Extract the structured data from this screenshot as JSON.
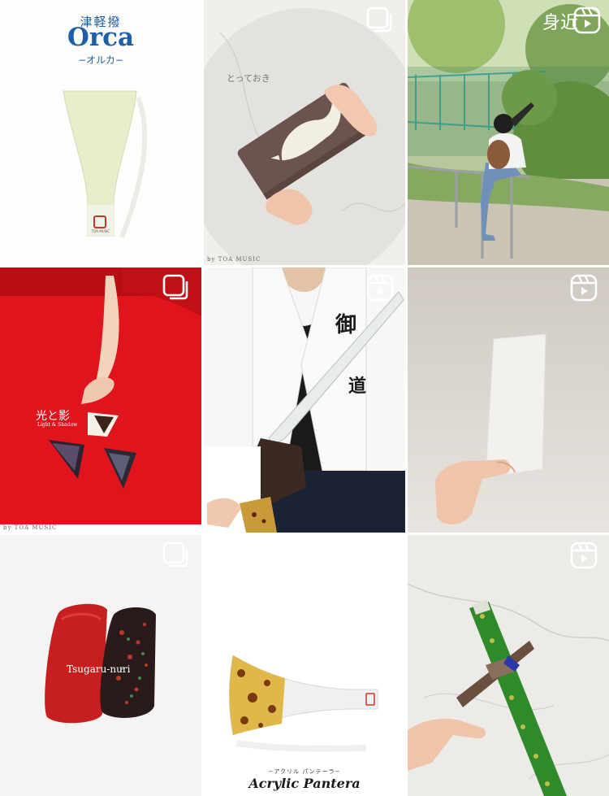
{
  "posts": [
    {
      "type": "reel",
      "badge_icon": "reels-icon",
      "title_jp": "津軽撥",
      "title_en": "Orca",
      "subtitle": "−オルカ−",
      "logo_text": "TOA MUSIC"
    },
    {
      "type": "carousel",
      "badge_icon": "carousel-icon",
      "caption": "とっておき",
      "footer": "by TOA MUSIC"
    },
    {
      "type": "reel",
      "badge_icon": "reels-icon",
      "overlay_text": "身近"
    },
    {
      "type": "carousel",
      "badge_icon": "carousel-icon",
      "title_jp": "光と影",
      "title_en": "Light & Shadow",
      "footer": "by TOA MUSIC"
    },
    {
      "type": "reel",
      "badge_icon": "reels-icon",
      "kanji_1": "御",
      "kanji_2": "道"
    },
    {
      "type": "reel",
      "badge_icon": "reels-icon"
    },
    {
      "type": "carousel",
      "badge_icon": "carousel-icon",
      "caption": "Tsugaru-nuri"
    },
    {
      "type": "reel",
      "badge_icon": "reels-icon",
      "subtitle": "−アクリル パンテーラ−",
      "title": "Acrylic Pantera"
    },
    {
      "type": "reel",
      "badge_icon": "reels-icon"
    }
  ],
  "colors": {
    "tile_gap": "#ffffff",
    "orca_blue": "#1f5fa8",
    "red_background": "#e0141c",
    "lacquer_red": "#c71f1f",
    "tortoise": "#7a3a10"
  }
}
